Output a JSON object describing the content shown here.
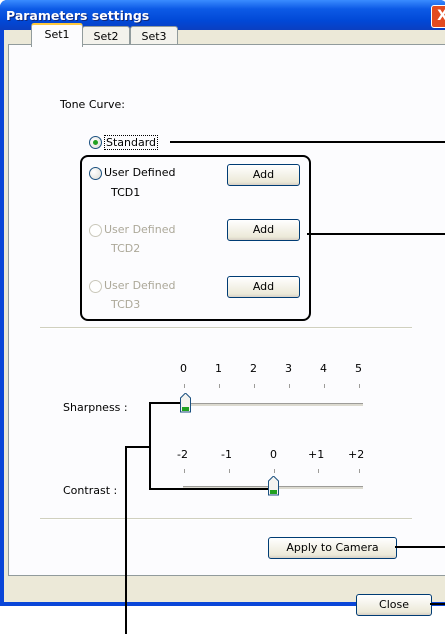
{
  "window": {
    "title": "Parameters settings",
    "close_glyph": "X"
  },
  "tabs": [
    "Set1",
    "Set2",
    "Set3"
  ],
  "tone_curve": {
    "label": "Tone Curve:",
    "standard": "Standard",
    "options": [
      {
        "label": "User Defined",
        "sub": "TCD1",
        "enabled": true
      },
      {
        "label": "User Defined",
        "sub": "TCD2",
        "enabled": false
      },
      {
        "label": "User Defined",
        "sub": "TCD3",
        "enabled": false
      }
    ],
    "add_label": "Add"
  },
  "sharpness": {
    "label": "Sharpness :",
    "ticks": [
      "0",
      "1",
      "2",
      "3",
      "4",
      "5"
    ],
    "value": "0"
  },
  "contrast": {
    "label": "Contrast :",
    "ticks": [
      "-2",
      "-1",
      "0",
      "+1",
      "+2"
    ],
    "value": "0"
  },
  "apply_label": "Apply to Camera",
  "close_label": "Close",
  "colors": {
    "titlebar": "#0148d6",
    "selected_radio": "#21a121",
    "active_tab_accent": "#ffc83c"
  }
}
